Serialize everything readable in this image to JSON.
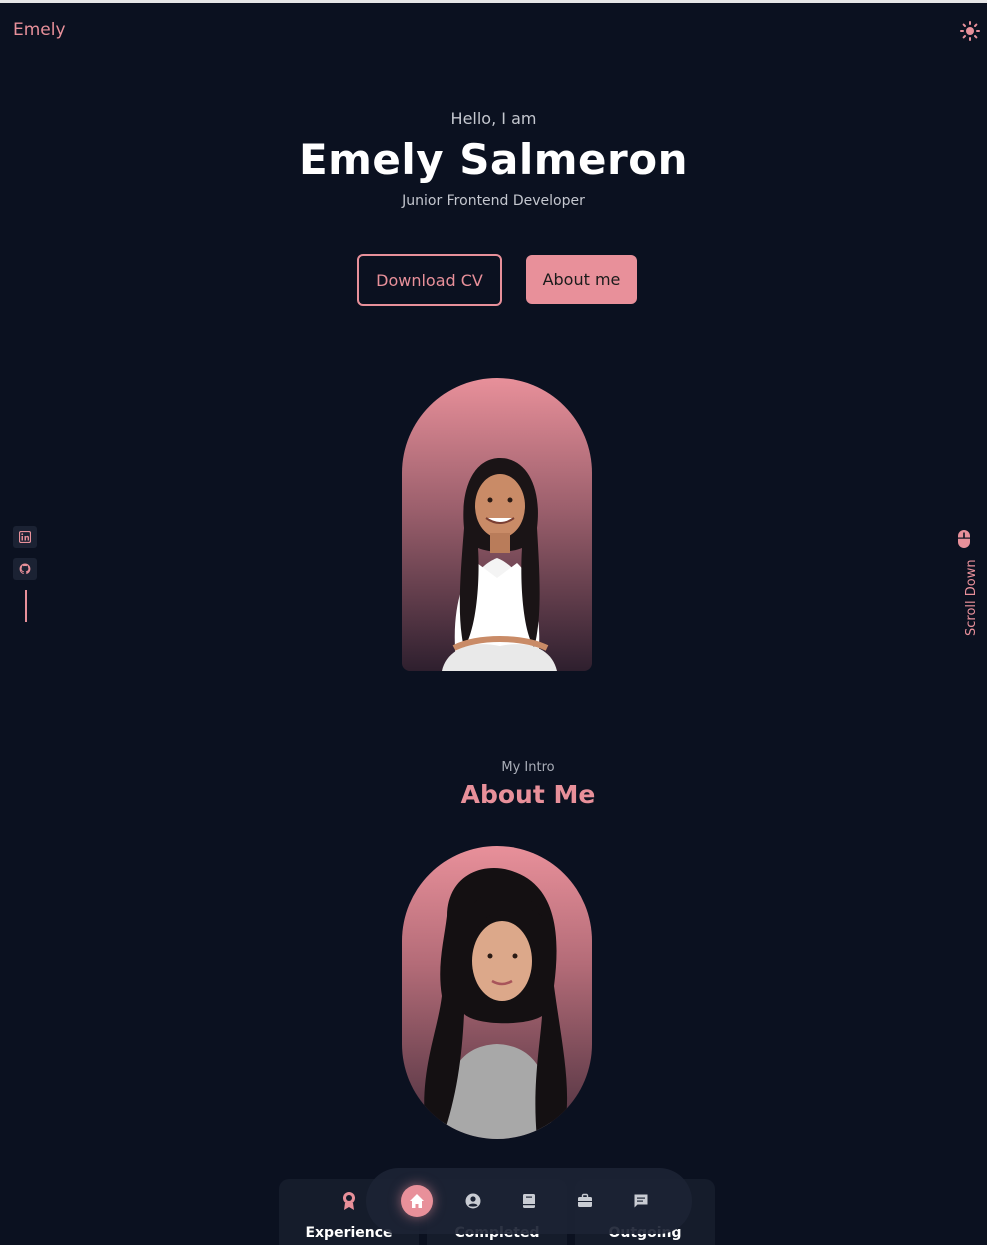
{
  "header": {
    "logo": "Emely",
    "theme_icon": "sun-icon"
  },
  "hero": {
    "greeting": "Hello, I am",
    "name": "Emely Salmeron",
    "role": "Junior Frontend Developer",
    "download_cv": "Download CV",
    "about_me": "About me"
  },
  "socials": [
    {
      "icon": "linkedin-icon"
    },
    {
      "icon": "github-icon"
    }
  ],
  "scroll": {
    "label": "Scroll Down",
    "icon": "mouse-icon"
  },
  "about": {
    "subtitle": "My Intro",
    "title": "About Me"
  },
  "stats": [
    {
      "icon": "award-icon",
      "title": "Experience"
    },
    {
      "icon": "briefcase-icon",
      "title": "Completed"
    },
    {
      "icon": "support-icon",
      "title": "Outgoing"
    }
  ],
  "nav": {
    "items": [
      {
        "icon": "home-icon",
        "active": true
      },
      {
        "icon": "user-icon",
        "active": false
      },
      {
        "icon": "book-icon",
        "active": false
      },
      {
        "icon": "briefcase-icon",
        "active": false
      },
      {
        "icon": "message-icon",
        "active": false
      }
    ]
  },
  "colors": {
    "background": "#0b1120",
    "accent": "#e8909a",
    "card": "#151c2b"
  }
}
